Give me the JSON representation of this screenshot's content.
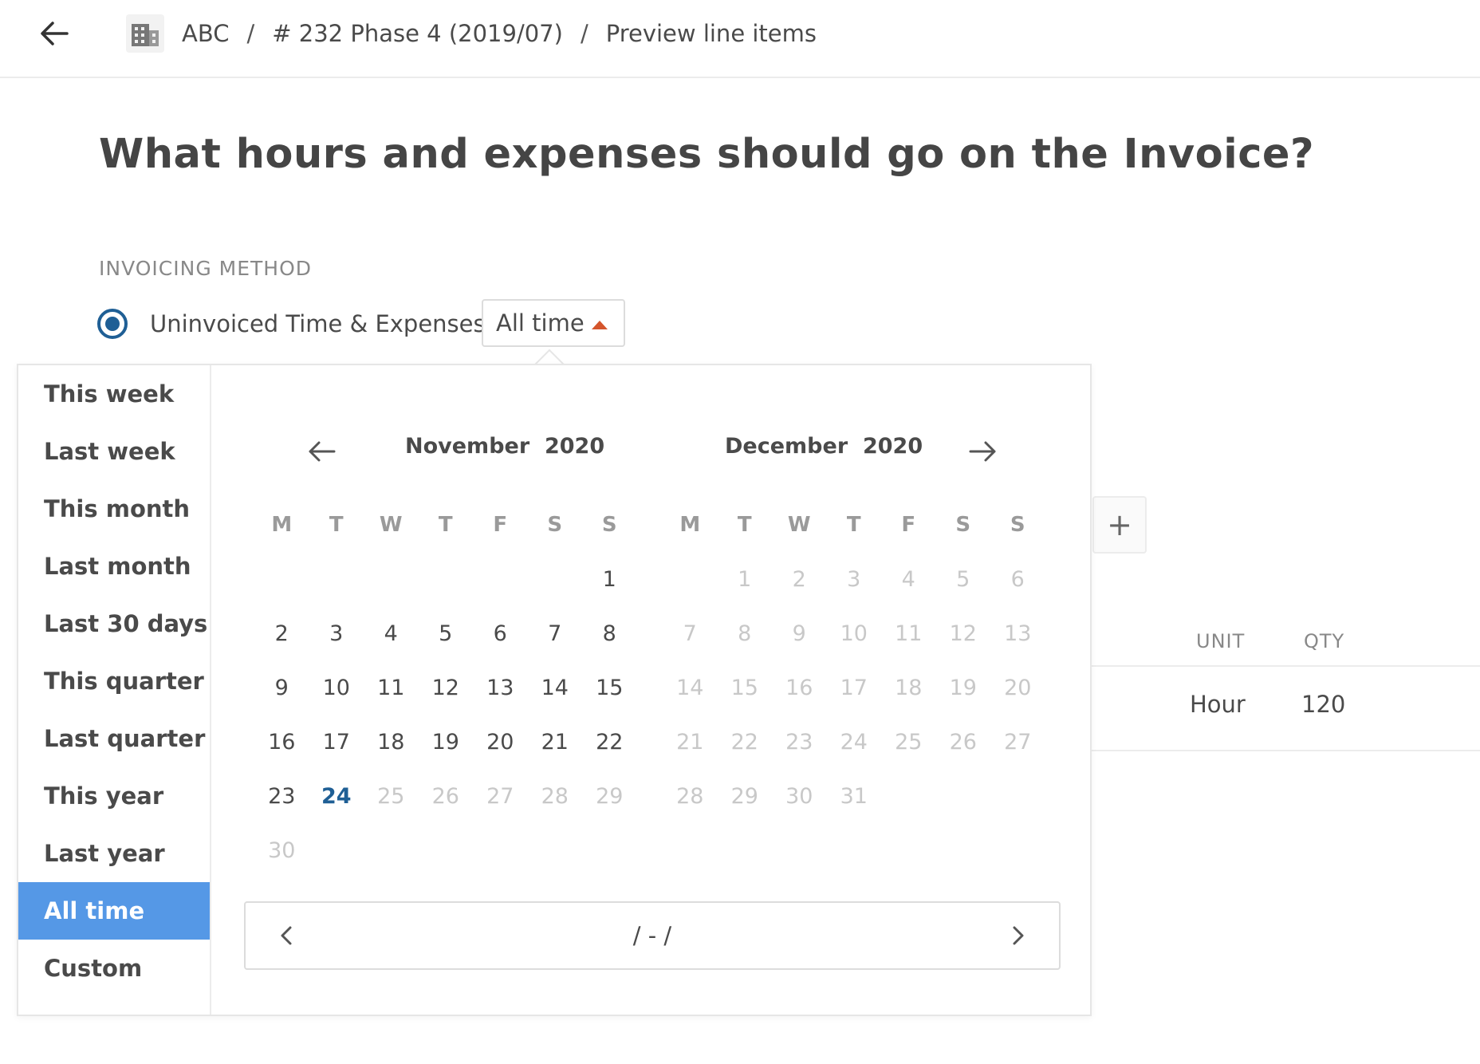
{
  "breadcrumb": {
    "items": [
      "ABC",
      "# 232 Phase 4 (2019/07)",
      "Preview line items"
    ],
    "separator": "/"
  },
  "page": {
    "title": "What hours and expenses should go on the Invoice?",
    "section_label": "INVOICING METHOD"
  },
  "method": {
    "option_label": "Uninvoiced Time & Expenses",
    "selected": true
  },
  "period_select": {
    "value": "All time"
  },
  "presets": [
    "This week",
    "Last week",
    "This month",
    "Last month",
    "Last 30 days",
    "This quarter",
    "Last quarter",
    "This year",
    "Last year",
    "All time",
    "Custom"
  ],
  "presets_active": "All time",
  "calendar": {
    "weekday_headers": [
      "M",
      "T",
      "W",
      "T",
      "F",
      "S",
      "S"
    ],
    "left": {
      "month": "November",
      "year": "2020",
      "weeks": [
        [
          "",
          "",
          "",
          "",
          "",
          "",
          "1"
        ],
        [
          "2",
          "3",
          "4",
          "5",
          "6",
          "7",
          "8"
        ],
        [
          "9",
          "10",
          "11",
          "12",
          "13",
          "14",
          "15"
        ],
        [
          "16",
          "17",
          "18",
          "19",
          "20",
          "21",
          "22"
        ],
        [
          "23",
          "24",
          "25",
          "26",
          "27",
          "28",
          "29"
        ],
        [
          "30",
          "",
          "",
          "",
          "",
          "",
          ""
        ]
      ]
    },
    "right": {
      "month": "December",
      "year": "2020",
      "weeks": [
        [
          "",
          "1",
          "2",
          "3",
          "4",
          "5",
          "6"
        ],
        [
          "7",
          "8",
          "9",
          "10",
          "11",
          "12",
          "13"
        ],
        [
          "14",
          "15",
          "16",
          "17",
          "18",
          "19",
          "20"
        ],
        [
          "21",
          "22",
          "23",
          "24",
          "25",
          "26",
          "27"
        ],
        [
          "28",
          "29",
          "30",
          "31",
          "",
          "",
          ""
        ]
      ]
    },
    "today": "24",
    "range_text": "/ - /"
  },
  "table": {
    "headers": [
      "UNIT",
      "QTY"
    ],
    "row": [
      "Hour",
      "120"
    ]
  },
  "colors": {
    "accent": "#1f5f95",
    "preset_active_bg": "#5598e6",
    "caret": "#d4552c"
  }
}
